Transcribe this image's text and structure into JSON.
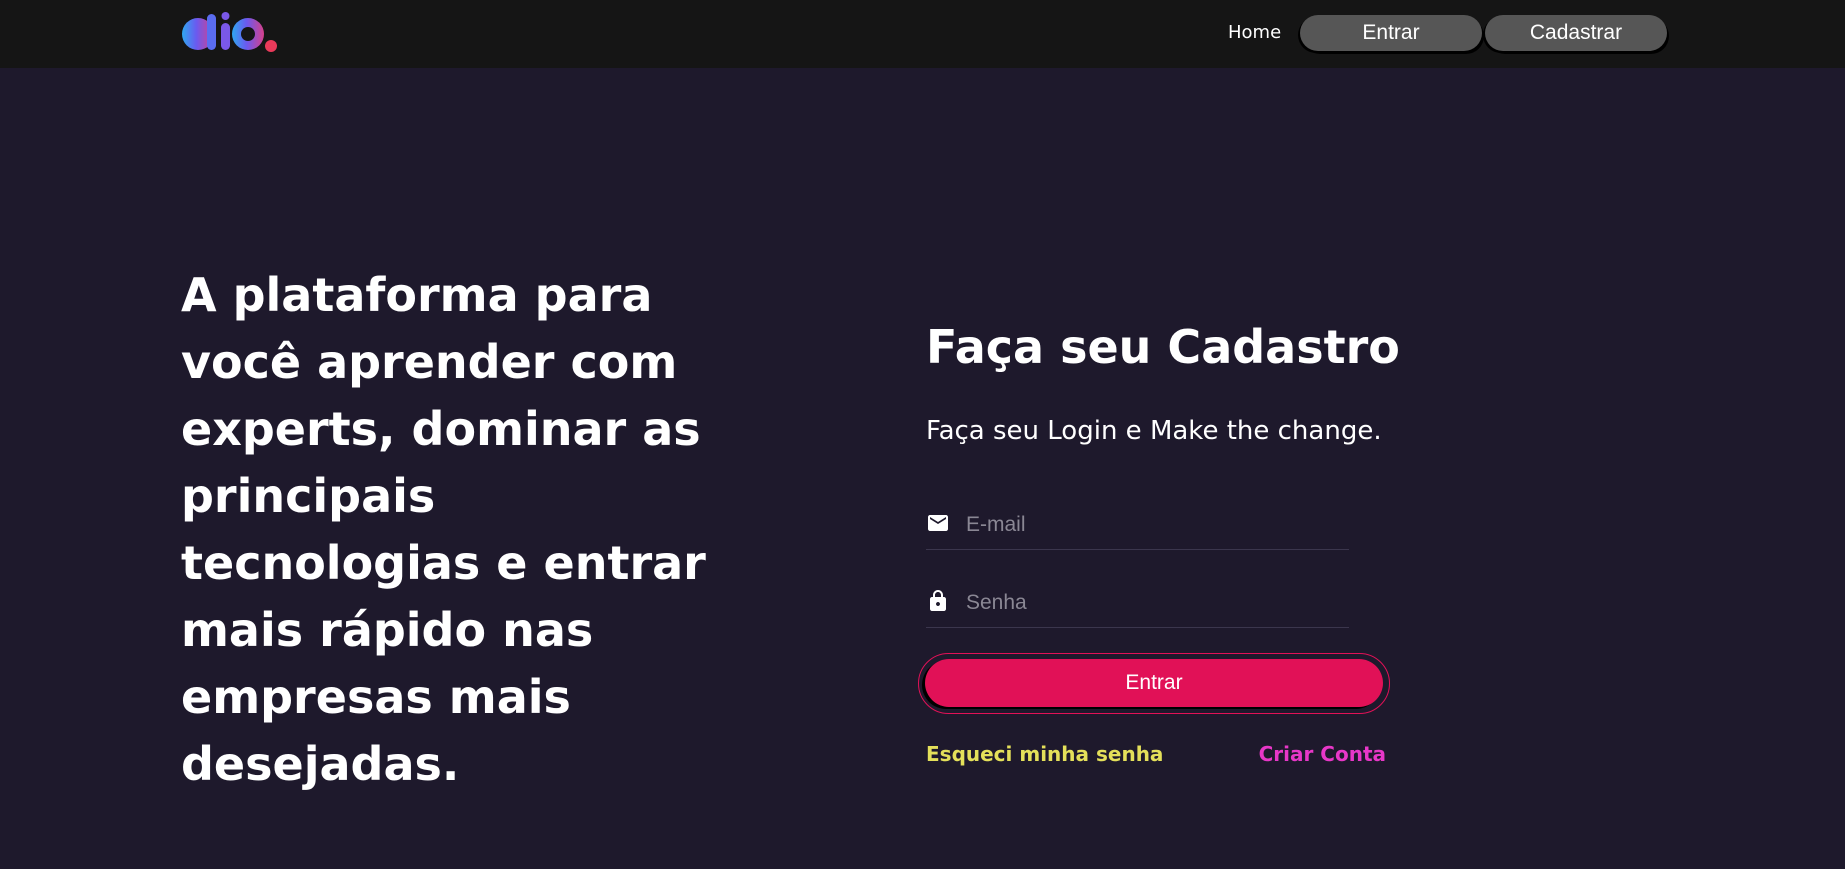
{
  "header": {
    "logo_icon": "dio-logo",
    "nav_home": "Home",
    "nav_entrar": "Entrar",
    "nav_cadastrar": "Cadastrar"
  },
  "hero": {
    "title": "A plataforma para você aprender com experts, dominar as principais tecnologias e entrar mais rápido nas empresas mais desejadas."
  },
  "form": {
    "title": "Faça seu Cadastro",
    "subtitle": "Faça seu Login e Make the change.",
    "email": {
      "placeholder": "E-mail",
      "value": "",
      "icon": "mail-icon"
    },
    "senha": {
      "placeholder": "Senha",
      "value": "",
      "icon": "lock-icon"
    },
    "submit_label": "Entrar",
    "forgot_label": "Esqueci minha senha",
    "create_label": "Criar Conta"
  },
  "colors": {
    "background": "#1e192c",
    "topbar": "#151515",
    "accent": "#e11157",
    "forgot_link": "#e4e05a",
    "create_link": "#e837c8"
  }
}
